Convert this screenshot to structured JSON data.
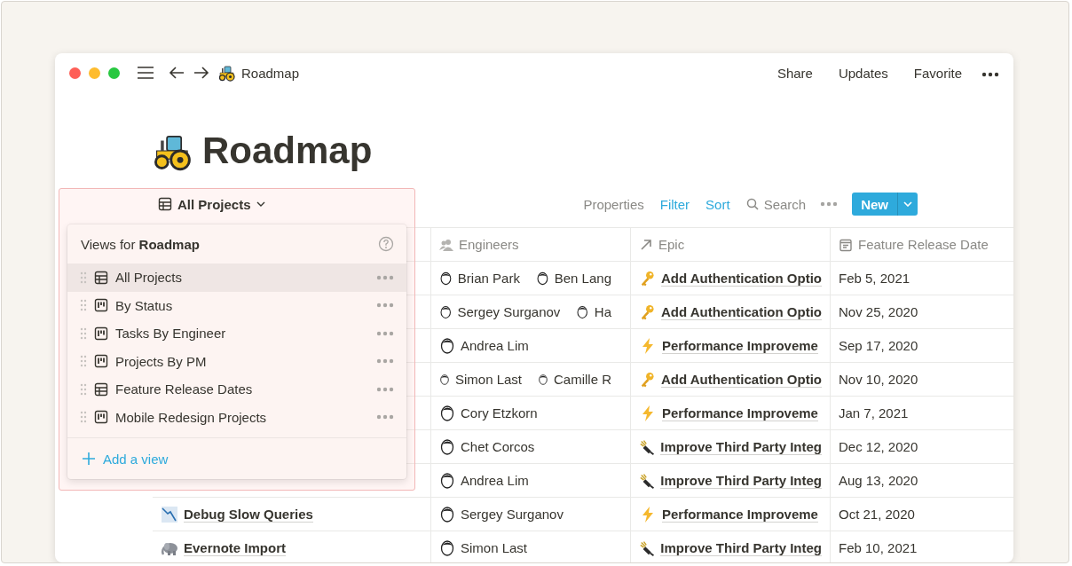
{
  "window": {
    "title": "Roadmap",
    "actions": [
      "Share",
      "Updates",
      "Favorite"
    ]
  },
  "page": {
    "title": "Roadmap"
  },
  "toolbar": {
    "view_tab": {
      "label": "All Projects"
    },
    "actions": [
      {
        "label": "Properties",
        "active": false
      },
      {
        "label": "Filter",
        "active": true
      },
      {
        "label": "Sort",
        "active": true
      }
    ],
    "search": {
      "label": "Search"
    },
    "new_button": {
      "label": "New"
    }
  },
  "views": {
    "title": "Views for **Roadmap**",
    "items": [
      {
        "label": "All Projects",
        "kind": "table",
        "selected": true
      },
      {
        "label": "By Status",
        "kind": "board",
        "selected": false
      },
      {
        "label": "Tasks By Engineer",
        "kind": "board",
        "selected": false
      },
      {
        "label": "Projects By PM",
        "kind": "board",
        "selected": false
      },
      {
        "label": "Feature Release Dates",
        "kind": "table",
        "selected": false
      },
      {
        "label": "Mobile Redesign Projects",
        "kind": "board",
        "selected": false
      }
    ],
    "add_label": "Add a view"
  },
  "table": {
    "columns": [
      {
        "label": "Engineers",
        "kind": "person"
      },
      {
        "label": "Epic",
        "kind": "relation"
      },
      {
        "label": "Feature Release Date",
        "kind": "date"
      }
    ],
    "rows": [
      {
        "engineers": [
          "Brian Park",
          "Ben Lang"
        ],
        "epic": {
          "kind": "key",
          "title": "Add Authentication Optio"
        },
        "date": "Feb 5, 2021"
      },
      {
        "engineers": [
          "Sergey Surganov",
          "Ha"
        ],
        "epic": {
          "kind": "key",
          "title": "Add Authentication Optio"
        },
        "date": "Nov 25, 2020"
      },
      {
        "engineers": [
          "Andrea Lim"
        ],
        "epic": {
          "kind": "bolt",
          "title": "Performance Improveme"
        },
        "date": "Sep 17, 2020"
      },
      {
        "engineers": [
          "Simon Last",
          "Camille R"
        ],
        "epic": {
          "kind": "key",
          "title": "Add Authentication Optio"
        },
        "date": "Nov 10, 2020"
      },
      {
        "engineers": [
          "Cory Etzkorn"
        ],
        "epic": {
          "kind": "bolt",
          "title": "Performance Improveme"
        },
        "date": "Jan 7, 2021"
      },
      {
        "engineers": [
          "Chet Corcos"
        ],
        "epic": {
          "kind": "plug",
          "title": "Improve Third Party Integ"
        },
        "date": "Dec 12, 2020"
      },
      {
        "engineers": [
          "Andrea Lim"
        ],
        "epic": {
          "kind": "plug",
          "title": "Improve Third Party Integ"
        },
        "date": "Aug 13, 2020"
      },
      {
        "name": {
          "kind": "chart",
          "title": "Debug Slow Queries"
        },
        "engineers": [
          "Sergey Surganov"
        ],
        "epic": {
          "kind": "bolt",
          "title": "Performance Improveme"
        },
        "date": "Oct 21, 2020"
      },
      {
        "name": {
          "kind": "elephant",
          "title": "Evernote Import"
        },
        "engineers": [
          "Simon Last"
        ],
        "epic": {
          "kind": "plug",
          "title": "Improve Third Party Integ"
        },
        "date": "Feb 10, 2021"
      }
    ]
  }
}
